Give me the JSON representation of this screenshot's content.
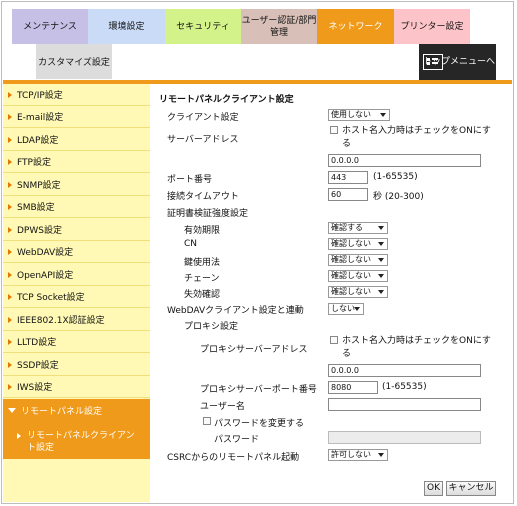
{
  "tabs_row1": [
    "メンテナンス",
    "環境設定",
    "セキュリティ",
    "ユーザー認証/部門管理",
    "ネットワーク",
    "プリンター設定"
  ],
  "tabs_row2": [
    "カスタマイズ設定"
  ],
  "home_button": "トップメニューへ",
  "sidebar": {
    "items": [
      "TCP/IP設定",
      "E-mail設定",
      "LDAP設定",
      "FTP設定",
      "SNMP設定",
      "SMB設定",
      "DPWS設定",
      "WebDAV設定",
      "OpenAPI設定",
      "TCP Socket設定",
      "IEEE802.1X認証設定",
      "LLTD設定",
      "SSDP設定",
      "IWS設定",
      "リモートパネル設定"
    ],
    "sub_item": "リモートパネルクライアント設定"
  },
  "form": {
    "title": "リモートパネルクライアント設定",
    "client_setting_label": "クライアント設定",
    "client_setting_value": "使用しない",
    "server_address_label": "サーバーアドレス",
    "server_address_hint": "ホスト名入力時はチェックをONにする",
    "server_address_value": "0.0.0.0",
    "port_label": "ポート番号",
    "port_value": "443",
    "port_range": "(1-65535)",
    "timeout_label": "接続タイムアウト",
    "timeout_value": "60",
    "timeout_range": "秒 (20-300)",
    "cert_label": "証明書検証強度設定",
    "cert_rows": [
      {
        "label": "有効期限",
        "value": "確認する"
      },
      {
        "label": "CN",
        "value": "確認しない"
      },
      {
        "label": "鍵使用法",
        "value": "確認しない"
      },
      {
        "label": "チェーン",
        "value": "確認しない"
      },
      {
        "label": "失効確認",
        "value": "確認しない"
      }
    ],
    "webdav_label": "WebDAVクライアント設定と連動",
    "webdav_value": "しない",
    "proxy_label": "プロキシ設定",
    "proxy_addr_label": "プロキシサーバーアドレス",
    "proxy_addr_hint": "ホスト名入力時はチェックをONにする",
    "proxy_addr_value": "0.0.0.0",
    "proxy_port_label": "プロキシサーバーポート番号",
    "proxy_port_value": "8080",
    "proxy_port_range": "(1-65535)",
    "user_label": "ユーザー名",
    "user_value": "",
    "change_pw_label": "パスワードを変更する",
    "password_label": "パスワード",
    "csrc_label": "CSRCからのリモートパネル起動",
    "csrc_value": "許可しない"
  },
  "buttons": {
    "ok": "OK",
    "cancel": "キャンセル"
  },
  "colors": {
    "accent": "#ef9a1a",
    "sidebar_bg": "#fff9b5"
  }
}
